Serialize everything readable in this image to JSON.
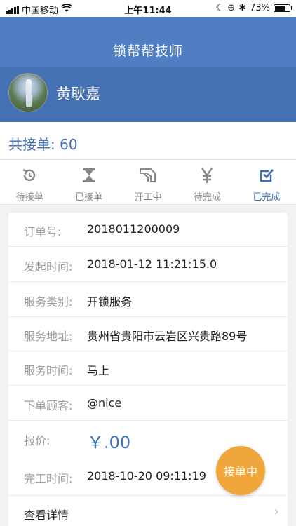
{
  "status_bar": {
    "carrier": "中国移动",
    "time": "上午11:44",
    "battery_pct": "73%",
    "battery_level": 0.73
  },
  "nav": {
    "title": "锁帮帮技师"
  },
  "profile": {
    "name": "黄耿嘉"
  },
  "summary": {
    "total_label": "共接单: 60"
  },
  "tabs": [
    {
      "label": "待接单",
      "icon": "history-icon"
    },
    {
      "label": "已接单",
      "icon": "hourglass-icon"
    },
    {
      "label": "开工中",
      "icon": "key-icon"
    },
    {
      "label": "待完成",
      "icon": "yen-icon"
    },
    {
      "label": "已完成",
      "icon": "checkbox-icon"
    }
  ],
  "active_tab": 4,
  "order": {
    "rows": [
      {
        "label": "订单号:",
        "value": "2018011200009"
      },
      {
        "label": "发起时间:",
        "value": "2018-01-12 11:21:15.0"
      },
      {
        "label": "服务类别:",
        "value": "开锁服务"
      },
      {
        "label": "服务地址:",
        "value": "贵州省贵阳市云岩区兴贵路89号"
      },
      {
        "label": "服务时间:",
        "value": "马上"
      },
      {
        "label": "下单顾客:",
        "value": "@nice"
      },
      {
        "label": "报价:",
        "value": "￥.00"
      },
      {
        "label": "完工时间:",
        "value": "2018-10-20 09:11:19"
      }
    ],
    "detail_label": "查看详情",
    "chevron": "›"
  },
  "fab": {
    "label": "接单中"
  },
  "colors": {
    "primary": "#4f7fc2",
    "banner": "#4472b5",
    "accent": "#3f6fb5",
    "fab": "#f0a63a"
  }
}
